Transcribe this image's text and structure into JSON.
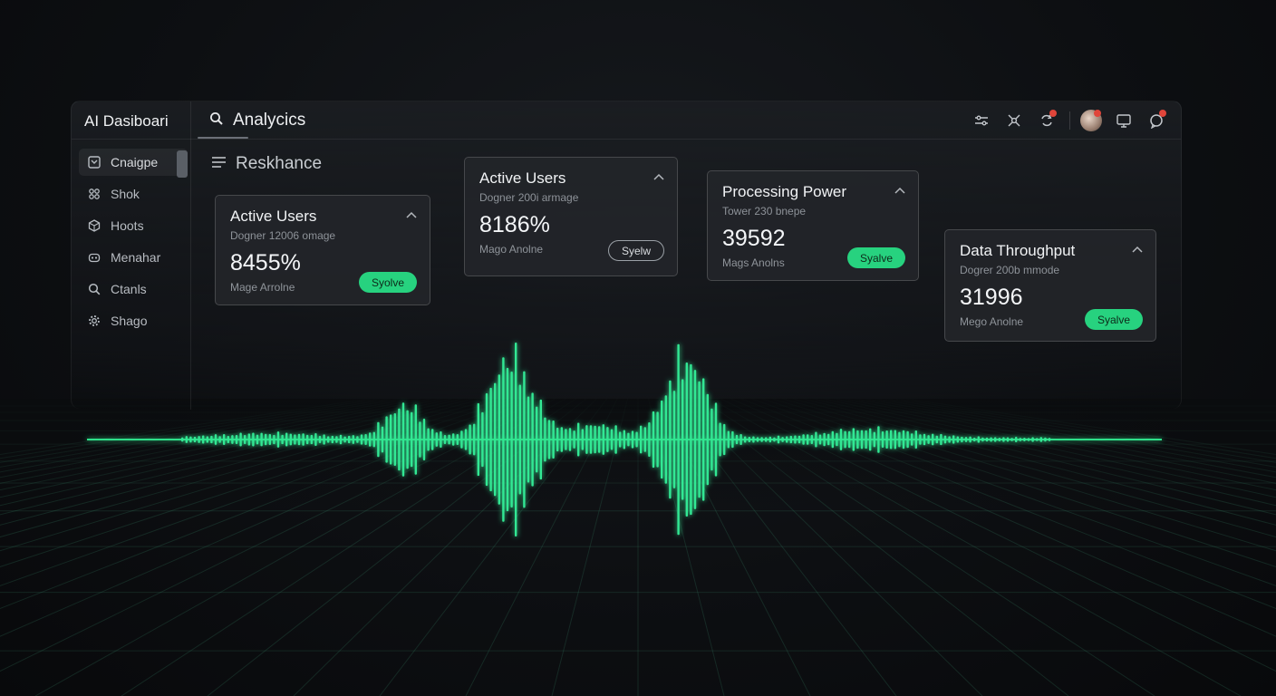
{
  "app": {
    "title": "AI  Dasiboari"
  },
  "header": {
    "search_label": "Analycics",
    "section_title": "Reskhance"
  },
  "sidebar": {
    "items": [
      {
        "label": "Cnaigpe",
        "icon": "square-check-icon",
        "active": true
      },
      {
        "label": "Shok",
        "icon": "nodes-icon",
        "active": false
      },
      {
        "label": "Hoots",
        "icon": "cube-icon",
        "active": false
      },
      {
        "label": "Menahar",
        "icon": "robot-icon",
        "active": false
      },
      {
        "label": "Ctanls",
        "icon": "search-icon",
        "active": false
      },
      {
        "label": "Shago",
        "icon": "gear-icon",
        "active": false
      }
    ]
  },
  "toolbar": {
    "icons": [
      "sliders-icon",
      "network-icon",
      "sync-icon",
      "avatar",
      "monitor-icon",
      "chat-icon"
    ]
  },
  "cards": [
    {
      "title": "Active Users",
      "subtitle": "Dogner 12006 omage",
      "value": "8455%",
      "footer": "Mage Arrolne",
      "button": "Syolve",
      "button_style": "green"
    },
    {
      "title": "Active Users",
      "subtitle": "Dogner 200i armage",
      "value": "8186%",
      "footer": "Mago Anolne",
      "button": "Syelw",
      "button_style": "outline"
    },
    {
      "title": "Processing Power",
      "subtitle": "Tower 230 bnepe",
      "value": "39592",
      "footer": "Mags Anolns",
      "button": "Syalve",
      "button_style": "green"
    },
    {
      "title": "Data Throughput",
      "subtitle": "Dogrer 200b mmode",
      "value": "31996",
      "footer": "Mego Anolne",
      "button": "Syalve",
      "button_style": "green"
    }
  ],
  "colors": {
    "accent": "#27d27f",
    "background": "#0d0f12",
    "panel": "#22252a",
    "alert": "#e0453a"
  }
}
